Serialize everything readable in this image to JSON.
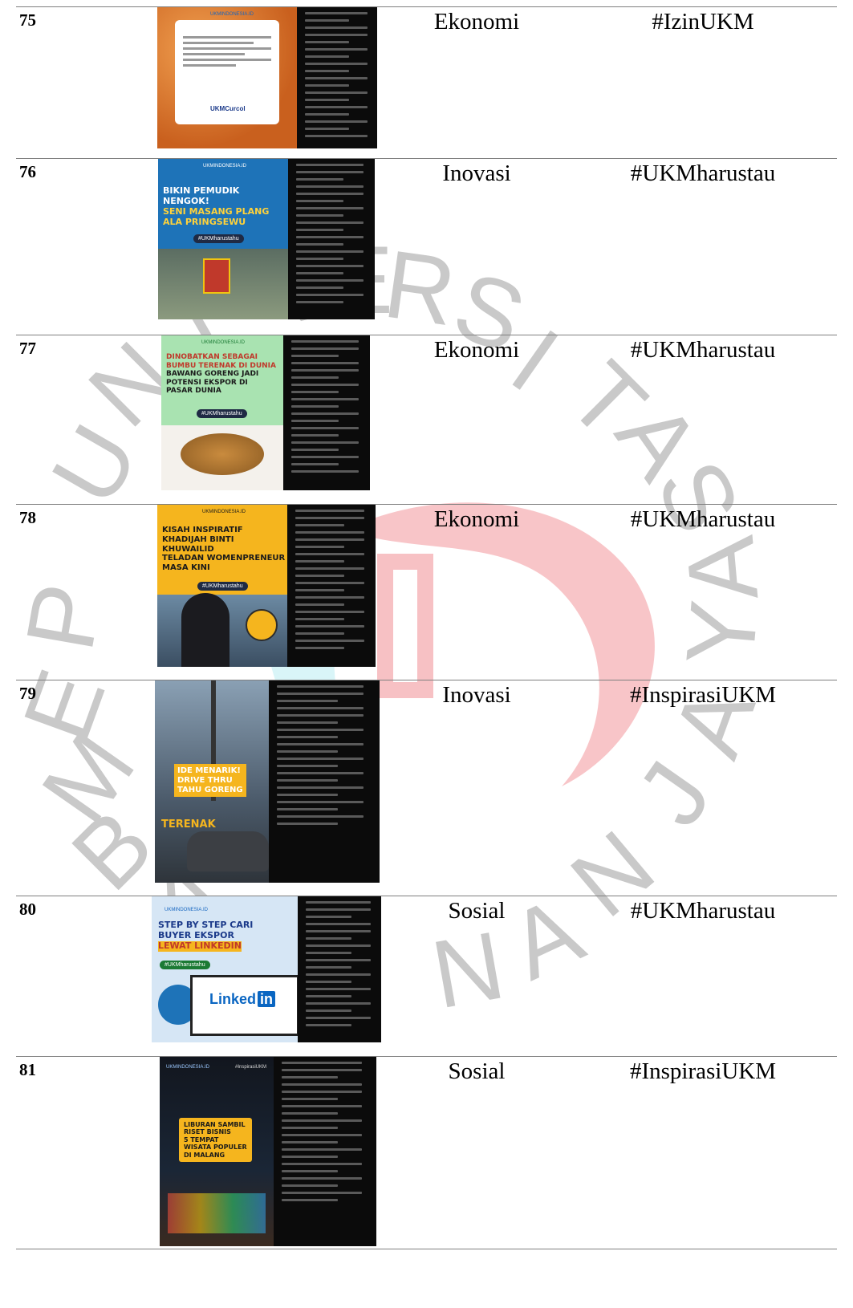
{
  "rows": [
    {
      "no": "75",
      "category": "Ekonomi",
      "hashtag": "#IzinUKM",
      "post": {
        "logo": "UKMINDONESIA.ID",
        "brand": "UKMCurcol",
        "bg": "#d9772c"
      }
    },
    {
      "no": "76",
      "category": "Inovasi",
      "hashtag": "#UKMharustau",
      "post": {
        "logo": "UKMINDONESIA.ID",
        "headline": [
          "BIKIN PEMUDIK NENGOK!",
          "SENI MASANG PLANG",
          "ALA PRINGSEWU"
        ],
        "tag": "#UKMharustahu",
        "bg": "#1e73b8"
      }
    },
    {
      "no": "77",
      "category": "Ekonomi",
      "hashtag": "#UKMharustau",
      "post": {
        "logo": "UKMINDONESIA.ID",
        "headline": [
          "DINOBATKAN SEBAGAI",
          "BUMBU TERENAK DI DUNIA",
          "BAWANG GORENG JADI",
          "POTENSI EKSPOR DI",
          "PASAR DUNIA"
        ],
        "tag": "#UKMharustahu",
        "bg": "#a9e3b1"
      }
    },
    {
      "no": "78",
      "category": "Ekonomi",
      "hashtag": "#UKMharustau",
      "post": {
        "logo": "UKMINDONESIA.ID",
        "headline": [
          "KISAH INSPIRATIF",
          "KHADIJAH BINTI KHUWAILID",
          "TELADAN WOMENPRENEUR",
          "MASA KINI"
        ],
        "tag": "#UKMharustahu",
        "bg": "#f5b51e"
      }
    },
    {
      "no": "79",
      "category": "Inovasi",
      "hashtag": "#InspirasiUKM",
      "post": {
        "headline": [
          "IDE MENARIK!",
          "DRIVE THRU",
          "TAHU GORENG"
        ],
        "overlay": "TERENAK",
        "bg": "#4b5a6a"
      }
    },
    {
      "no": "80",
      "category": "Sosial",
      "hashtag": "#UKMharustau",
      "post": {
        "logo": "UKMINDONESIA.ID",
        "headline": [
          "STEP BY STEP CARI",
          "BUYER EKSPOR",
          "LEWAT LINKEDIN"
        ],
        "tag": "#UKMharustahu",
        "brand": "Linked",
        "brand_in": "in",
        "bg": "#d6e6f5"
      }
    },
    {
      "no": "81",
      "category": "Sosial",
      "hashtag": "#InspirasiUKM",
      "post": {
        "logo": "UKMINDONESIA.ID",
        "corner": "#InspirasiUKM",
        "headline": [
          "LIBURAN SAMBIL",
          "RISET BISNIS",
          "5 TEMPAT",
          "WISATA POPULER",
          "DI MALANG"
        ],
        "bg": "#12161e"
      }
    }
  ],
  "watermark": [
    "U",
    "N",
    "I",
    "V",
    "E",
    "R",
    "S",
    "I",
    "T",
    "A",
    "S",
    "P",
    "E",
    "M",
    "B",
    "A",
    "N",
    "A",
    "N",
    "J",
    "A",
    "Y",
    "A"
  ]
}
